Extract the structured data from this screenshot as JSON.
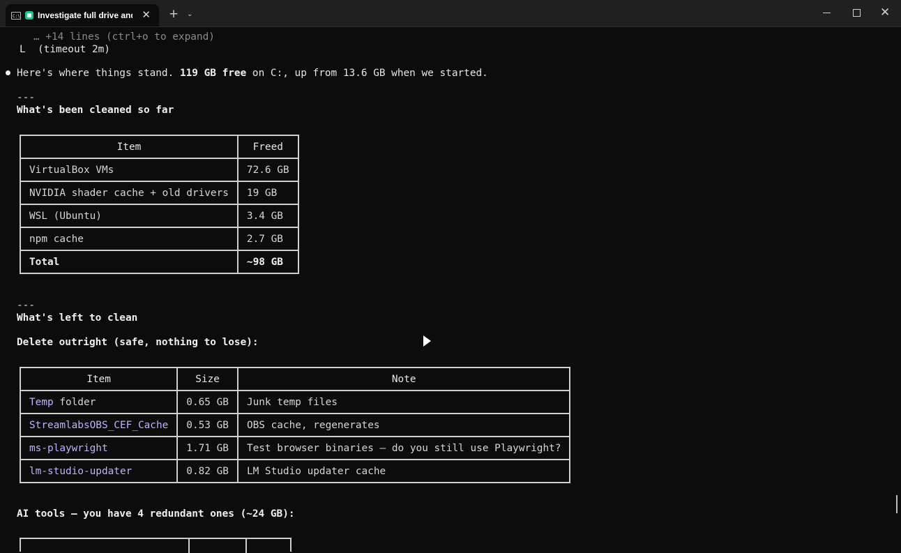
{
  "window": {
    "tab_title": "Investigate full drive and p",
    "tab_term_glyph": "C:\\",
    "tab_close": "✕",
    "new_tab": "+",
    "tab_dropdown": "⌄",
    "close_glyph": "✕"
  },
  "terminal": {
    "line_expand": "… +14 lines (ctrl+o to expand)",
    "line_timeout": "L  (timeout 2m)",
    "summary_pre": "Here's where things stand. ",
    "summary_bold": "119 GB free",
    "summary_post": " on C:, up from 13.6 GB when we started.",
    "rule1": "---",
    "heading_cleaned": "What's been cleaned so far",
    "cleaned_table": {
      "headers": [
        "Item",
        "Freed"
      ],
      "rows": [
        [
          "VirtualBox VMs",
          "72.6 GB"
        ],
        [
          "NVIDIA shader cache + old drivers",
          "19 GB"
        ],
        [
          "WSL (Ubuntu)",
          "3.4 GB"
        ],
        [
          "npm cache",
          "2.7 GB"
        ]
      ],
      "total_label": "Total",
      "total_value": "~98 GB"
    },
    "rule2": "---",
    "heading_left": "What's left to clean",
    "subheading_delete": "Delete outright (safe, nothing to lose):",
    "delete_table": {
      "headers": [
        "Item",
        "Size",
        "Note"
      ],
      "rows": [
        {
          "item_link": "Temp",
          "item_rest": " folder",
          "size": "0.65 GB",
          "note": "Junk temp files"
        },
        {
          "item_link": "StreamlabsOBS_CEF_Cache",
          "item_rest": "",
          "size": "0.53 GB",
          "note": "OBS cache, regenerates"
        },
        {
          "item_link": "ms-playwright",
          "item_rest": "",
          "size": "1.71 GB",
          "note": "Test browser binaries — do you still use Playwright?"
        },
        {
          "item_link": "lm-studio-updater",
          "item_rest": "",
          "size": "0.82 GB",
          "note": "LM Studio updater cache"
        }
      ]
    },
    "ai_tools_line": "AI tools — you have 4 redundant ones (~24 GB):"
  },
  "colors": {
    "background": "#0c0c0c",
    "text": "#cccccc",
    "link": "#b9b5ff",
    "border": "#d0d0d0"
  }
}
